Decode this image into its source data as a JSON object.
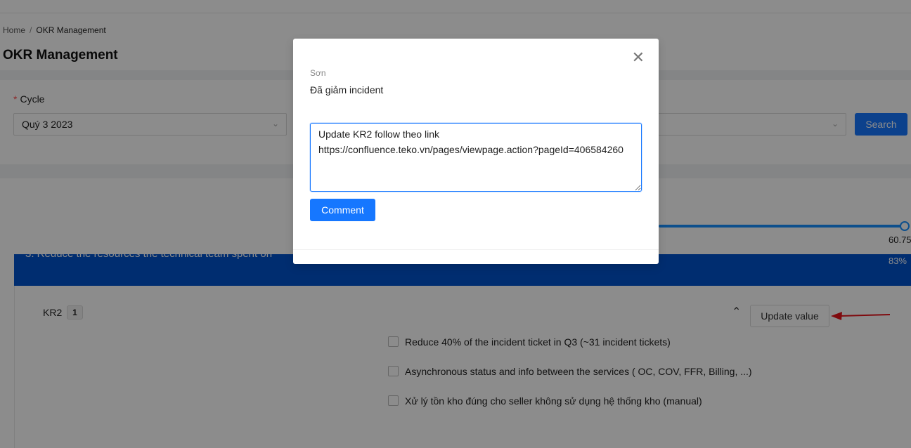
{
  "breadcrumb": {
    "home": "Home",
    "separator": "/",
    "current": "OKR Management"
  },
  "page": {
    "title": "OKR Management"
  },
  "filters": {
    "cycle_label": "Cycle",
    "required_mark": "*",
    "cycle_value": "Quý 3 2023",
    "second_select_value": "",
    "search_button": "Search"
  },
  "progress": {
    "value_label": "60.75",
    "fraction": 1.0
  },
  "objective": {
    "title": "3. Reduce the resources the technical team spent on",
    "percent": "83%"
  },
  "key_result": {
    "label": "KR2",
    "badge": "1",
    "update_button": "Update value",
    "items": [
      {
        "text": "Reduce 40% of the incident ticket in Q3 (~31 incident tickets)",
        "checked": false
      },
      {
        "text": "Asynchronous status and info between the services ( OC, COV, FFR, Billing, ...)",
        "checked": false
      },
      {
        "text": "Xử lý tồn kho đúng cho seller không sử dụng hệ thống kho (manual)",
        "checked": false
      }
    ]
  },
  "modal": {
    "close_glyph": "✕",
    "author": "Sơn",
    "message": "Đã giảm incident",
    "textarea_value": "Update KR2 follow theo link\nhttps://confluence.teko.vn/pages/viewpage.action?pageId=406584260",
    "comment_button": "Comment"
  },
  "colors": {
    "primary": "#1677ff",
    "objective_bar": "#0052cc",
    "annotation_arrow": "#e8131b"
  }
}
